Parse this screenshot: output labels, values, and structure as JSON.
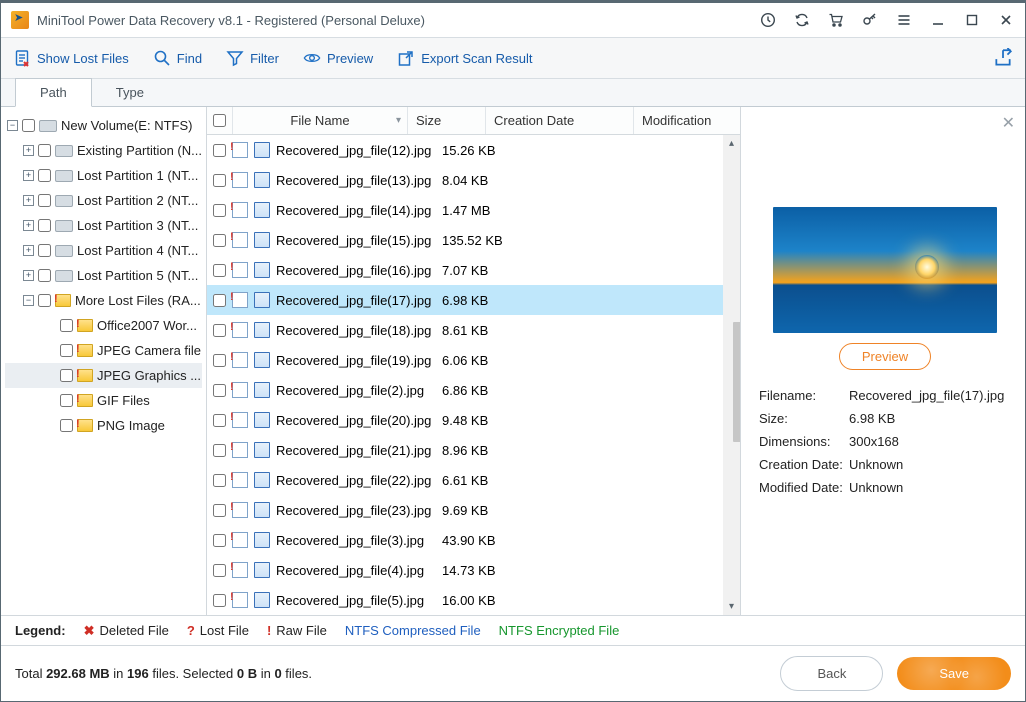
{
  "window": {
    "title": "MiniTool Power Data Recovery v8.1 - Registered (Personal Deluxe)"
  },
  "toolbar": {
    "show_lost": "Show Lost Files",
    "find": "Find",
    "filter": "Filter",
    "preview": "Preview",
    "export": "Export Scan Result"
  },
  "tabs": {
    "path": "Path",
    "type": "Type"
  },
  "tree": {
    "root": "New Volume(E: NTFS)",
    "items": [
      "Existing Partition (N...",
      "Lost Partition 1 (NT...",
      "Lost Partition 2 (NT...",
      "Lost Partition 3 (NT...",
      "Lost Partition 4 (NT...",
      "Lost Partition 5 (NT..."
    ],
    "more": "More Lost Files (RA...",
    "sub": [
      "Office2007 Wor...",
      "JPEG Camera file",
      "JPEG Graphics ...",
      "GIF Files",
      "PNG Image"
    ]
  },
  "columns": {
    "name": "File Name",
    "size": "Size",
    "cdate": "Creation Date",
    "mod": "Modification"
  },
  "files": [
    {
      "name": "Recovered_jpg_file(12).jpg",
      "size": "15.26 KB"
    },
    {
      "name": "Recovered_jpg_file(13).jpg",
      "size": "8.04 KB"
    },
    {
      "name": "Recovered_jpg_file(14).jpg",
      "size": "1.47 MB"
    },
    {
      "name": "Recovered_jpg_file(15).jpg",
      "size": "135.52 KB"
    },
    {
      "name": "Recovered_jpg_file(16).jpg",
      "size": "7.07 KB"
    },
    {
      "name": "Recovered_jpg_file(17).jpg",
      "size": "6.98 KB"
    },
    {
      "name": "Recovered_jpg_file(18).jpg",
      "size": "8.61 KB"
    },
    {
      "name": "Recovered_jpg_file(19).jpg",
      "size": "6.06 KB"
    },
    {
      "name": "Recovered_jpg_file(2).jpg",
      "size": "6.86 KB"
    },
    {
      "name": "Recovered_jpg_file(20).jpg",
      "size": "9.48 KB"
    },
    {
      "name": "Recovered_jpg_file(21).jpg",
      "size": "8.96 KB"
    },
    {
      "name": "Recovered_jpg_file(22).jpg",
      "size": "6.61 KB"
    },
    {
      "name": "Recovered_jpg_file(23).jpg",
      "size": "9.69 KB"
    },
    {
      "name": "Recovered_jpg_file(3).jpg",
      "size": "43.90 KB"
    },
    {
      "name": "Recovered_jpg_file(4).jpg",
      "size": "14.73 KB"
    },
    {
      "name": "Recovered_jpg_file(5).jpg",
      "size": "16.00 KB"
    }
  ],
  "selected_index": 5,
  "preview": {
    "button": "Preview",
    "labels": {
      "fn": "Filename:",
      "sz": "Size:",
      "dim": "Dimensions:",
      "cd": "Creation Date:",
      "md": "Modified Date:"
    },
    "values": {
      "fn": "Recovered_jpg_file(17).jpg",
      "sz": "6.98 KB",
      "dim": "300x168",
      "cd": "Unknown",
      "md": "Unknown"
    }
  },
  "legend": {
    "title": "Legend:",
    "deleted": "Deleted File",
    "lost": "Lost File",
    "raw": "Raw File",
    "ntfs_c": "NTFS Compressed File",
    "ntfs_e": "NTFS Encrypted File"
  },
  "status": {
    "total_label": "Total ",
    "total_size": "292.68 MB",
    "in": " in ",
    "file_count": "196",
    "files_label": " files.  Selected ",
    "sel_size": "0 B",
    "in2": " in ",
    "sel_count": "0",
    "files2": " files.",
    "back": "Back",
    "save": "Save"
  }
}
